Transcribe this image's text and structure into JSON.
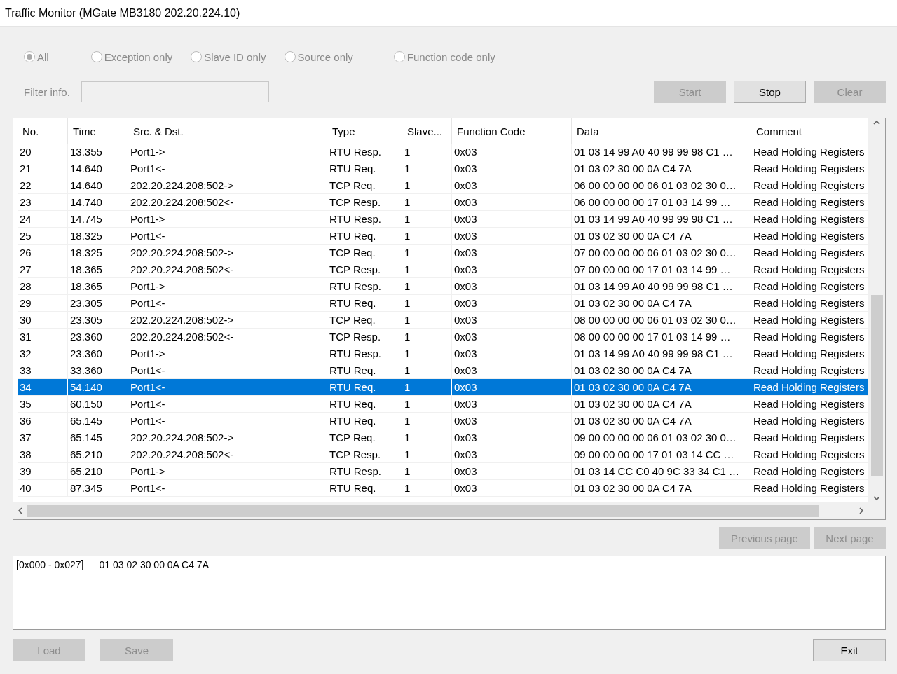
{
  "window": {
    "title": "Traffic Monitor (MGate MB3180 202.20.224.10)"
  },
  "filters": [
    {
      "label": "All",
      "selected": true,
      "disabled": true
    },
    {
      "label": "Exception only",
      "selected": false,
      "disabled": true
    },
    {
      "label": "Slave ID only",
      "selected": false,
      "disabled": true
    },
    {
      "label": "Source only",
      "selected": false,
      "disabled": true
    },
    {
      "label": "Function code only",
      "selected": false,
      "disabled": true
    }
  ],
  "filter_info": {
    "label": "Filter info.",
    "disabled": true
  },
  "controls": [
    {
      "label": "Start",
      "disabled": true
    },
    {
      "label": "Stop",
      "disabled": false
    },
    {
      "label": "Clear",
      "disabled": true
    }
  ],
  "table": {
    "columns": [
      "No.",
      "Time",
      "Src. & Dst.",
      "Type",
      "Slave...",
      "Function Code",
      "Data",
      "Comment"
    ],
    "rows": [
      {
        "cells": [
          "20",
          "13.355",
          "Port1->",
          "RTU Resp.",
          "1",
          "0x03",
          "01 03 14 99 A0 40 99 99 98 C1 …",
          "Read Holding Registers"
        ],
        "selected": false
      },
      {
        "cells": [
          "21",
          "14.640",
          "Port1<-",
          "RTU Req.",
          "1",
          "0x03",
          "01 03 02 30 00 0A C4 7A",
          "Read Holding Registers"
        ],
        "selected": false
      },
      {
        "cells": [
          "22",
          "14.640",
          "202.20.224.208:502->",
          "TCP Req.",
          "1",
          "0x03",
          "06 00 00 00 00 06 01 03 02 30 0…",
          "Read Holding Registers"
        ],
        "selected": false
      },
      {
        "cells": [
          "23",
          "14.740",
          "202.20.224.208:502<-",
          "TCP Resp.",
          "1",
          "0x03",
          "06 00 00 00 00 17 01 03 14 99 …",
          "Read Holding Registers"
        ],
        "selected": false
      },
      {
        "cells": [
          "24",
          "14.745",
          "Port1->",
          "RTU Resp.",
          "1",
          "0x03",
          "01 03 14 99 A0 40 99 99 98 C1 …",
          "Read Holding Registers"
        ],
        "selected": false
      },
      {
        "cells": [
          "25",
          "18.325",
          "Port1<-",
          "RTU Req.",
          "1",
          "0x03",
          "01 03 02 30 00 0A C4 7A",
          "Read Holding Registers"
        ],
        "selected": false
      },
      {
        "cells": [
          "26",
          "18.325",
          "202.20.224.208:502->",
          "TCP Req.",
          "1",
          "0x03",
          "07 00 00 00 00 06 01 03 02 30 0…",
          "Read Holding Registers"
        ],
        "selected": false
      },
      {
        "cells": [
          "27",
          "18.365",
          "202.20.224.208:502<-",
          "TCP Resp.",
          "1",
          "0x03",
          "07 00 00 00 00 17 01 03 14 99 …",
          "Read Holding Registers"
        ],
        "selected": false
      },
      {
        "cells": [
          "28",
          "18.365",
          "Port1->",
          "RTU Resp.",
          "1",
          "0x03",
          "01 03 14 99 A0 40 99 99 98 C1 …",
          "Read Holding Registers"
        ],
        "selected": false
      },
      {
        "cells": [
          "29",
          "23.305",
          "Port1<-",
          "RTU Req.",
          "1",
          "0x03",
          "01 03 02 30 00 0A C4 7A",
          "Read Holding Registers"
        ],
        "selected": false
      },
      {
        "cells": [
          "30",
          "23.305",
          "202.20.224.208:502->",
          "TCP Req.",
          "1",
          "0x03",
          "08 00 00 00 00 06 01 03 02 30 0…",
          "Read Holding Registers"
        ],
        "selected": false
      },
      {
        "cells": [
          "31",
          "23.360",
          "202.20.224.208:502<-",
          "TCP Resp.",
          "1",
          "0x03",
          "08 00 00 00 00 17 01 03 14 99 …",
          "Read Holding Registers"
        ],
        "selected": false
      },
      {
        "cells": [
          "32",
          "23.360",
          "Port1->",
          "RTU Resp.",
          "1",
          "0x03",
          "01 03 14 99 A0 40 99 99 98 C1 …",
          "Read Holding Registers"
        ],
        "selected": false
      },
      {
        "cells": [
          "33",
          "33.360",
          "Port1<-",
          "RTU Req.",
          "1",
          "0x03",
          "01 03 02 30 00 0A C4 7A",
          "Read Holding Registers"
        ],
        "selected": false
      },
      {
        "cells": [
          "34",
          "54.140",
          "Port1<-",
          "RTU Req.",
          "1",
          "0x03",
          "01 03 02 30 00 0A C4 7A",
          "Read Holding Registers"
        ],
        "selected": true
      },
      {
        "cells": [
          "35",
          "60.150",
          "Port1<-",
          "RTU Req.",
          "1",
          "0x03",
          "01 03 02 30 00 0A C4 7A",
          "Read Holding Registers"
        ],
        "selected": false
      },
      {
        "cells": [
          "36",
          "65.145",
          "Port1<-",
          "RTU Req.",
          "1",
          "0x03",
          "01 03 02 30 00 0A C4 7A",
          "Read Holding Registers"
        ],
        "selected": false
      },
      {
        "cells": [
          "37",
          "65.145",
          "202.20.224.208:502->",
          "TCP Req.",
          "1",
          "0x03",
          "09 00 00 00 00 06 01 03 02 30 0…",
          "Read Holding Registers"
        ],
        "selected": false
      },
      {
        "cells": [
          "38",
          "65.210",
          "202.20.224.208:502<-",
          "TCP Resp.",
          "1",
          "0x03",
          "09 00 00 00 00 17 01 03 14 CC …",
          "Read Holding Registers"
        ],
        "selected": false
      },
      {
        "cells": [
          "39",
          "65.210",
          "Port1->",
          "RTU Resp.",
          "1",
          "0x03",
          "01 03 14 CC C0 40 9C 33 34 C1 …",
          "Read Holding Registers"
        ],
        "selected": false
      },
      {
        "cells": [
          "40",
          "87.345",
          "Port1<-",
          "RTU Req.",
          "1",
          "0x03",
          "01 03 02 30 00 0A C4 7A",
          "Read Holding Registers"
        ],
        "selected": false
      }
    ]
  },
  "paging": [
    {
      "label": "Previous page",
      "disabled": true
    },
    {
      "label": "Next page",
      "disabled": true
    }
  ],
  "detail": {
    "range": "[0x000 - 0x027]",
    "bytes": "01 03 02 30 00 0A C4 7A"
  },
  "file_buttons": [
    {
      "label": "Load",
      "disabled": true
    },
    {
      "label": "Save",
      "disabled": true
    }
  ],
  "exit_button": {
    "label": "Exit",
    "disabled": false
  }
}
